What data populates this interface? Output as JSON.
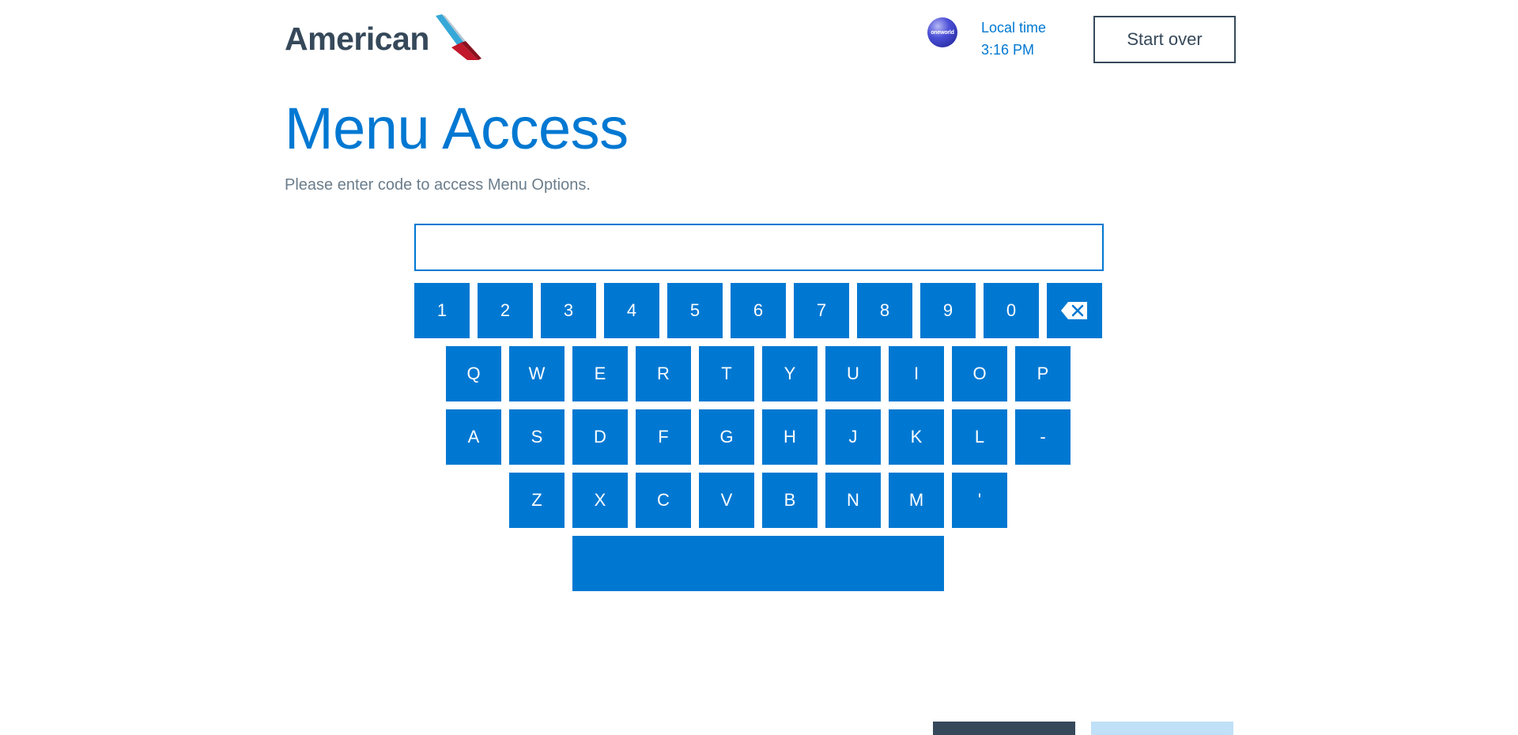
{
  "header": {
    "logo_text": "American",
    "oneworld_label": "oneworld",
    "local_time_label": "Local time",
    "local_time_value": "3:16 PM",
    "start_over_label": "Start over"
  },
  "main": {
    "title": "Menu Access",
    "subtitle": "Please enter code to access Menu Options.",
    "code_input_value": ""
  },
  "keyboard": {
    "row1": [
      "1",
      "2",
      "3",
      "4",
      "5",
      "6",
      "7",
      "8",
      "9",
      "0"
    ],
    "backspace_icon": "backspace-icon",
    "row2": [
      "Q",
      "W",
      "E",
      "R",
      "T",
      "Y",
      "U",
      "I",
      "O",
      "P"
    ],
    "row3": [
      "A",
      "S",
      "D",
      "F",
      "G",
      "H",
      "J",
      "K",
      "L",
      "-"
    ],
    "row4": [
      "Z",
      "X",
      "C",
      "V",
      "B",
      "N",
      "M",
      "'"
    ],
    "space_label": ""
  },
  "colors": {
    "accent_blue": "#0078d2",
    "dark_slate": "#36495a",
    "subtitle_gray": "#6b7d8c",
    "light_blue": "#bfe0f7"
  }
}
